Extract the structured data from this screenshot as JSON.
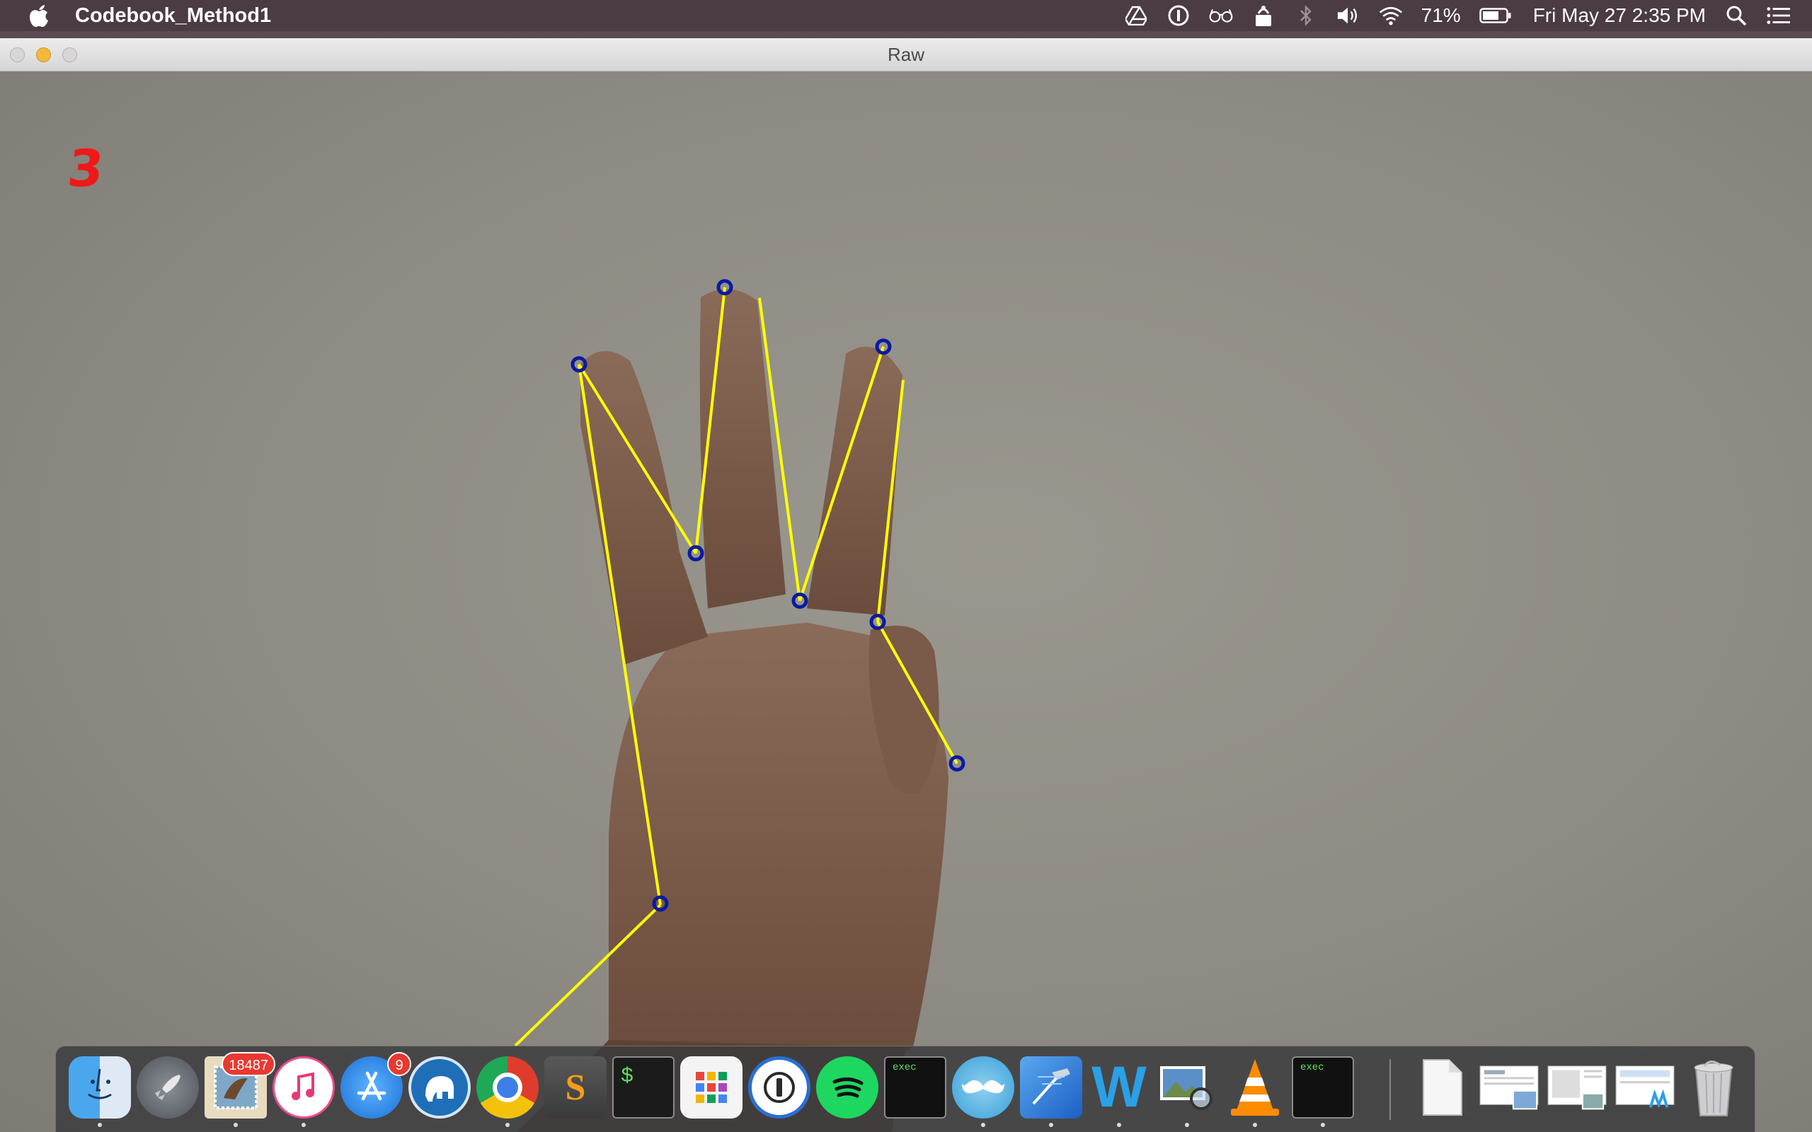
{
  "menubar": {
    "app_name": "Codebook_Method1",
    "battery_percent": "71%",
    "datetime": "Fri May 27  2:35 PM",
    "status_icons": [
      "google-drive-icon",
      "1password-icon",
      "glasses-icon",
      "airdrop-icon",
      "bluetooth-icon",
      "volume-icon",
      "wifi-icon",
      "battery-icon",
      "spotlight-search-icon",
      "notification-center-icon"
    ]
  },
  "window": {
    "title": "Raw",
    "finger_count": "3"
  },
  "overlay": {
    "line_color": "#ffff00",
    "point_color": "#0a1aa0"
  },
  "dock": {
    "apps": [
      "finder",
      "launchpad",
      "mail",
      "itunes",
      "app-store",
      "mamp",
      "chrome",
      "sublime-text",
      "terminal",
      "launchpad-grid",
      "1password",
      "spotify",
      "exec",
      "mustache",
      "xcode",
      "word",
      "preview",
      "vlc",
      "exec"
    ],
    "mail_badge": "18487",
    "app_store_badge": "9",
    "exec_label": "exec",
    "sublime_label": "S",
    "terminal_label": "$",
    "word_label": "W"
  }
}
